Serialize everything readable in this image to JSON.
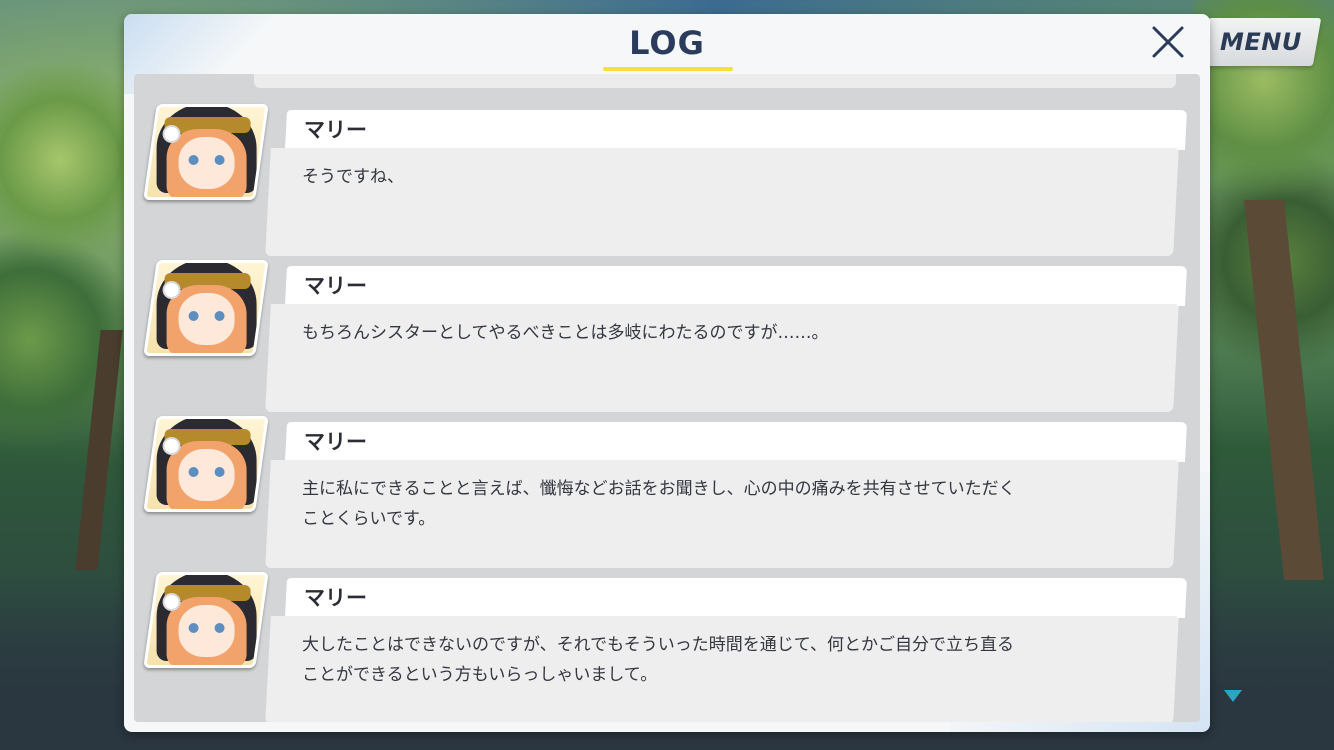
{
  "menu": {
    "label": "MENU"
  },
  "log": {
    "title": "LOG",
    "entries": [
      {
        "speaker": "マリー",
        "text": "そうですね、"
      },
      {
        "speaker": "マリー",
        "text": "もちろんシスターとしてやるべきことは多岐にわたるのですが……。"
      },
      {
        "speaker": "マリー",
        "text": "主に私にできることと言えば、懺悔などお話をお聞きし、心の中の痛みを共有させていただく\nことくらいです。"
      },
      {
        "speaker": "マリー",
        "text": "大したことはできないのですが、それでもそういった時間を通じて、何とかご自分で立ち直る\nことができるという方もいらっしゃいまして。"
      }
    ]
  },
  "icons": {
    "close": "close-x-icon",
    "scroll": "scroll-down-triangle-icon",
    "avatar": "character-portrait-marie"
  },
  "colors": {
    "title": "#2b3b5c",
    "accent_underline": "#f3e23a",
    "indicator": "#2fa2c8",
    "panel": "#f5f7f9",
    "log_area": "#d3d5d7"
  }
}
